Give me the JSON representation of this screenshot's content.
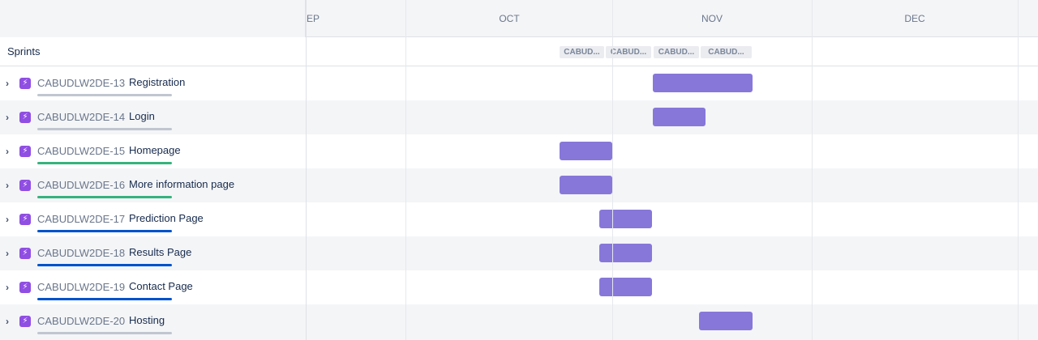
{
  "months": {
    "sep": "EP",
    "oct": "OCT",
    "nov": "NOV",
    "dec": "DEC"
  },
  "sprints": {
    "label": "Sprints",
    "chips": [
      "CABUD...",
      "CABUD...",
      "CABUD...",
      "CABUD..."
    ]
  },
  "issues": [
    {
      "key": "CABUDLW2DE-13",
      "title": "Registration",
      "status_color": "#c1c7d0"
    },
    {
      "key": "CABUDLW2DE-14",
      "title": "Login",
      "status_color": "#c1c7d0"
    },
    {
      "key": "CABUDLW2DE-15",
      "title": "Homepage",
      "status_color": "#36b37e"
    },
    {
      "key": "CABUDLW2DE-16",
      "title": "More information page",
      "status_color": "#36b37e"
    },
    {
      "key": "CABUDLW2DE-17",
      "title": "Prediction Page",
      "status_color": "#0052cc"
    },
    {
      "key": "CABUDLW2DE-18",
      "title": "Results Page",
      "status_color": "#0052cc"
    },
    {
      "key": "CABUDLW2DE-19",
      "title": "Contact Page",
      "status_color": "#0052cc"
    },
    {
      "key": "CABUDLW2DE-20",
      "title": "Hosting",
      "status_color": "#c1c7d0"
    }
  ],
  "colors": {
    "epic": "#904ee2",
    "bar": "#8777d9",
    "todo": "#c1c7d0",
    "done": "#36b37e",
    "in_progress": "#0052cc"
  },
  "icons": {
    "expand": "chevron-right-icon",
    "issue_type": "epic-lightning-icon"
  }
}
